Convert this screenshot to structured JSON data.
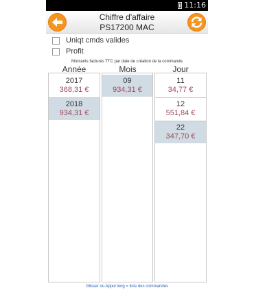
{
  "status": {
    "time": "11:16"
  },
  "header": {
    "title": "Chiffre d'affaire",
    "subtitle": "PS17200 MAC"
  },
  "options": {
    "valides_label": "Uniqt cmds valides",
    "profit_label": "Profit"
  },
  "caption": "Montants facturés TTC par date de création de la commande",
  "columns": {
    "annee": "Année",
    "mois": "Mois",
    "jour": "Jour"
  },
  "annee": [
    {
      "label": "2017",
      "amount": "368,31 €",
      "selected": false
    },
    {
      "label": "2018",
      "amount": "934,31 €",
      "selected": true
    }
  ],
  "mois": [
    {
      "label": "09",
      "amount": "934,31 €",
      "selected": true
    }
  ],
  "jour": [
    {
      "label": "11",
      "amount": "34,77 €",
      "selected": false
    },
    {
      "label": "12",
      "amount": "551,84 €",
      "selected": false
    },
    {
      "label": "22",
      "amount": "347,70 €",
      "selected": true
    }
  ],
  "footer": "Glisser ou Appui long = liste des commandes",
  "colors": {
    "accent": "#f7941d",
    "selected_bg": "#d0dbe3",
    "amount": "#a0495c",
    "footer_link": "#2a5db0"
  },
  "icons": {
    "back": "arrow-left-icon",
    "refresh": "refresh-icon"
  }
}
